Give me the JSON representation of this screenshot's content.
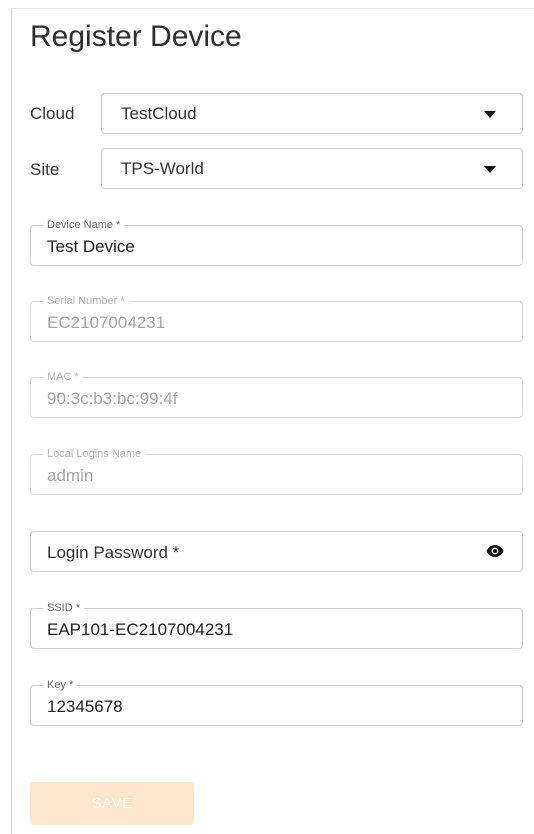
{
  "title": "Register Device",
  "cloud": {
    "label": "Cloud",
    "value": "TestCloud"
  },
  "site": {
    "label": "Site",
    "value": "TPS-World"
  },
  "fields": {
    "device_name": {
      "label": "Device Name *",
      "value": "Test Device"
    },
    "serial_number": {
      "label": "Serial Number *",
      "value": "EC2107004231"
    },
    "mac": {
      "label": "MAC *",
      "value": "90:3c:b3:bc:99:4f"
    },
    "local_logins_name": {
      "label": "Local Logins Name",
      "value": "admin"
    },
    "login_password": {
      "placeholder": "Login Password *"
    },
    "ssid": {
      "label": "SSID *",
      "value": "EAP101-EC2107004231"
    },
    "key": {
      "label": "Key *",
      "value": "12345678"
    }
  },
  "save_button": {
    "label": "SAVE"
  },
  "icons": {
    "dropdown": "caret-down-icon",
    "visibility": "eye-icon"
  },
  "colors": {
    "save_disabled": "#fde6cb",
    "border": "#cfcfcf"
  }
}
